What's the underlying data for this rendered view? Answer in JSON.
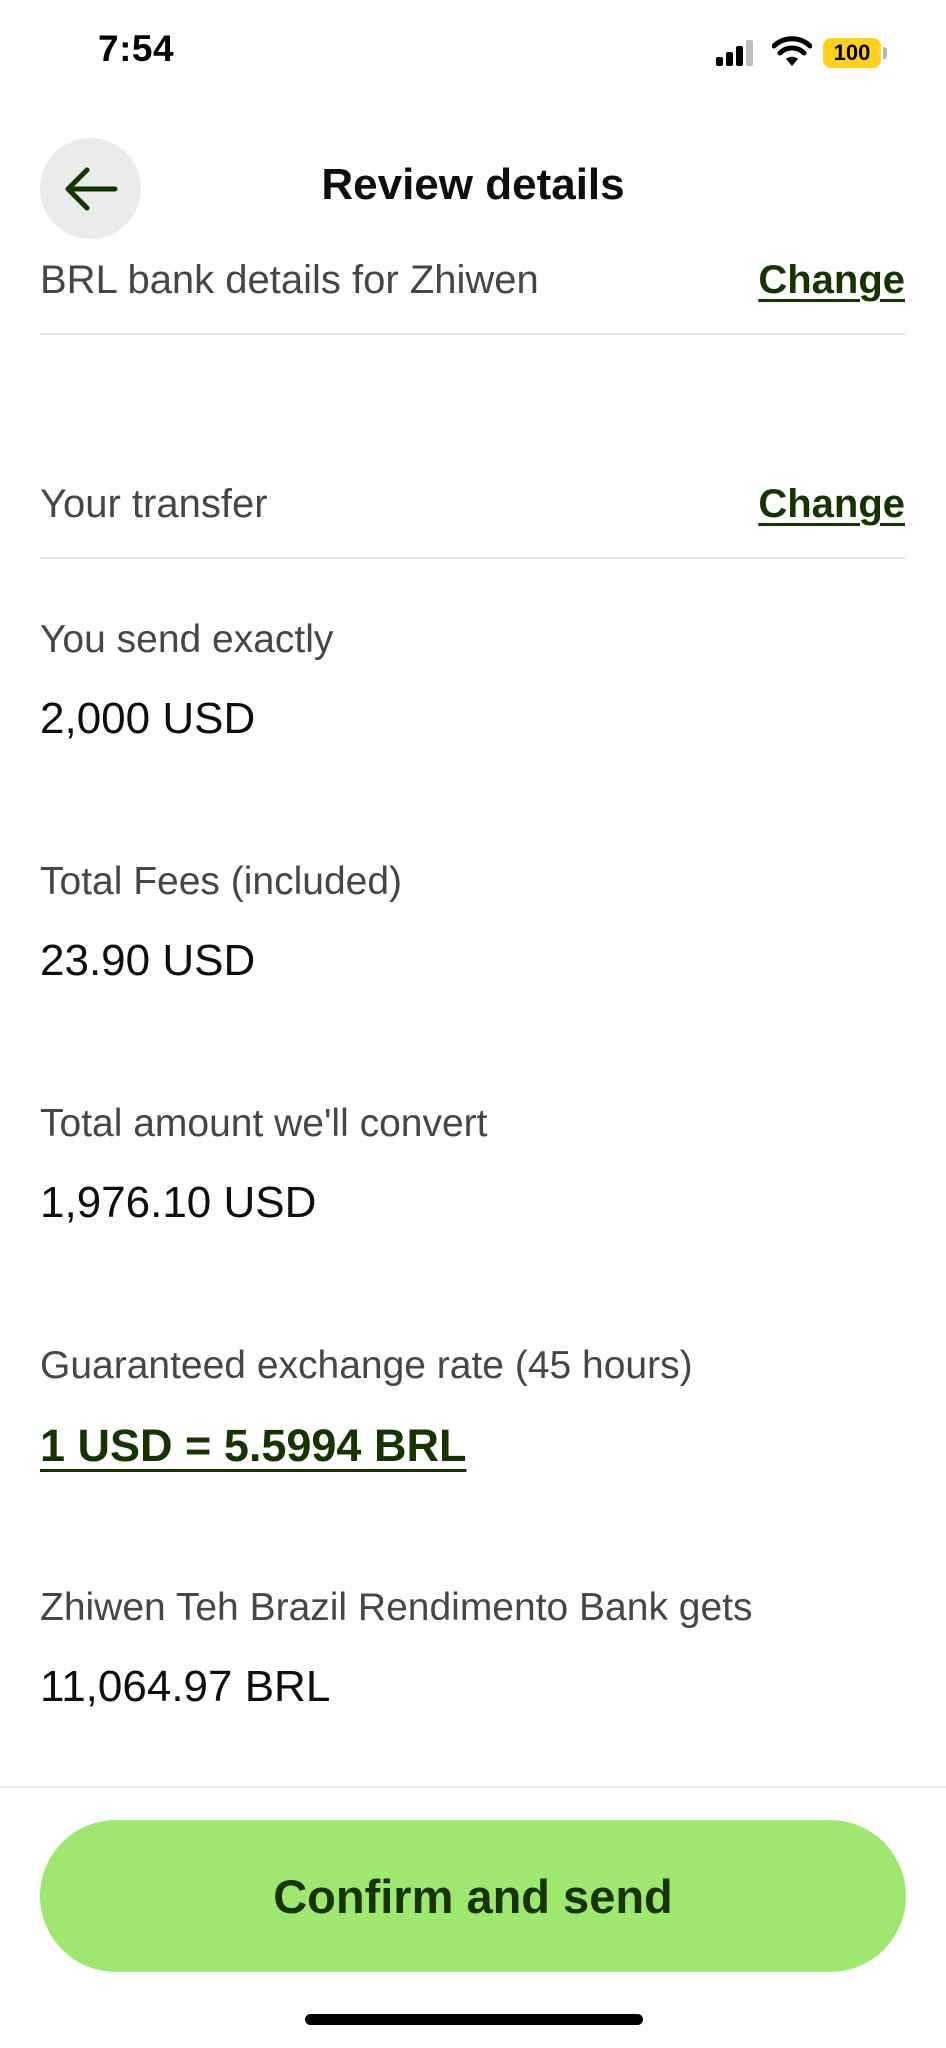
{
  "status_bar": {
    "time": "7:54",
    "battery": "100",
    "icons": [
      "signal-icon",
      "wifi-icon",
      "battery-icon"
    ],
    "battery_color": "#ffd11a"
  },
  "header": {
    "back_icon": "arrow-left-icon",
    "title": "Review details"
  },
  "recipient_section": {
    "label": "BRL bank details for Zhiwen",
    "change_label": "Change"
  },
  "transfer_section": {
    "label": "Your transfer",
    "change_label": "Change"
  },
  "details": {
    "send_label": "You send exactly",
    "send_value": "2,000 USD",
    "fees_label": "Total Fees (included)",
    "fees_value": "23.90 USD",
    "convert_label": "Total amount we'll convert",
    "convert_value": "1,976.10 USD",
    "rate_label": "Guaranteed exchange rate (45 hours)",
    "rate_value": "1 USD = 5.5994 BRL",
    "receive_label": "Zhiwen Teh Brazil Rendimento Bank gets",
    "receive_value": "11,064.97 BRL"
  },
  "footer": {
    "confirm_label": "Confirm and send"
  },
  "colors": {
    "accent_green": "#9fe870",
    "link_green": "#163300",
    "secondary_text": "#454745"
  }
}
